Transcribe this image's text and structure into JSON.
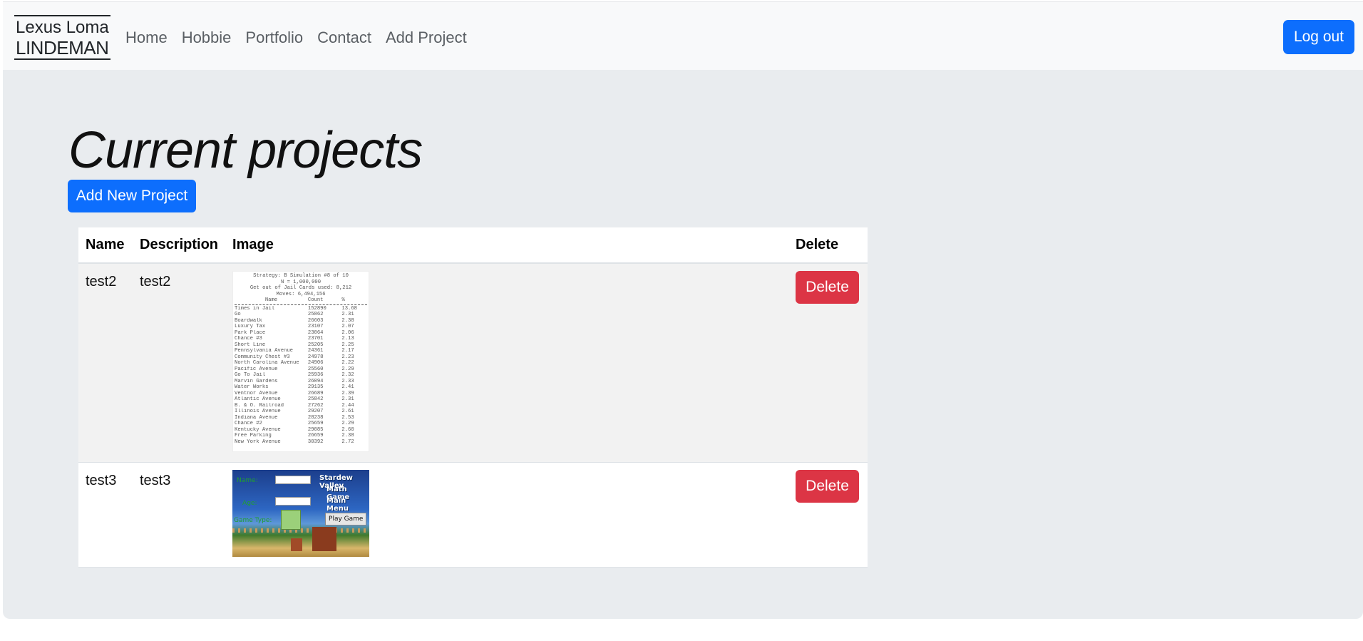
{
  "navbar": {
    "brand_line1": "Lexus Loma",
    "brand_line2": "LINDEMAN",
    "links": [
      "Home",
      "Hobbie",
      "Portfolio",
      "Contact",
      "Add Project"
    ],
    "logout_label": "Log out"
  },
  "main": {
    "title": "Current projects",
    "add_button": "Add New Project"
  },
  "table": {
    "headers": [
      "Name",
      "Description",
      "Image",
      "Delete"
    ],
    "rows": [
      {
        "name": "test2",
        "description": "test2",
        "delete_label": "Delete"
      },
      {
        "name": "test3",
        "description": "test3",
        "delete_label": "Delete"
      }
    ]
  },
  "thumb1": {
    "header_lines": [
      "Strategy: B Simulation #8 of 10",
      "N = 1,000,000",
      "Get out of Jail Cards used: 8,212",
      "Moves: 6,494,156"
    ],
    "col_headers": [
      "Name",
      "Count",
      "%"
    ],
    "rows": [
      [
        "Times in Jail",
        "152890",
        "13.68"
      ],
      [
        "Go",
        "25862",
        "2.31"
      ],
      [
        "Boardwalk",
        "26603",
        "2.38"
      ],
      [
        "Luxury Tax",
        "23107",
        "2.07"
      ],
      [
        "Park Place",
        "23064",
        "2.06"
      ],
      [
        "Chance #3",
        "23701",
        "2.13"
      ],
      [
        "Short Line",
        "25205",
        "2.25"
      ],
      [
        "Pennsylvania Avenue",
        "24361",
        "2.17"
      ],
      [
        "Community Chest #3",
        "24978",
        "2.23"
      ],
      [
        "North Carolina Avenue",
        "24906",
        "2.22"
      ],
      [
        "Pacific Avenue",
        "25560",
        "2.29"
      ],
      [
        "Go To Jail",
        "25936",
        "2.32"
      ],
      [
        "Marvin Gardens",
        "26094",
        "2.33"
      ],
      [
        "Water Works",
        "29135",
        "2.41"
      ],
      [
        "Ventnor Avenue",
        "26689",
        "2.39"
      ],
      [
        "Atlantic Avenue",
        "25842",
        "2.31"
      ],
      [
        "B. & O. Railroad",
        "27262",
        "2.44"
      ],
      [
        "Illinois Avenue",
        "29207",
        "2.61"
      ],
      [
        "Indiana Avenue",
        "28238",
        "2.53"
      ],
      [
        "Chance #2",
        "25659",
        "2.29"
      ],
      [
        "Kentucky Avenue",
        "29085",
        "2.60"
      ],
      [
        "Free Parking",
        "26659",
        "2.38"
      ],
      [
        "New York Avenue",
        "30392",
        "2.72"
      ]
    ]
  },
  "thumb2": {
    "title_lines": [
      "Stardew Valley",
      "Math Game",
      "Main Menu"
    ],
    "name_label": "Name:",
    "age_label": "Age:",
    "game_type_label": "Game Type:",
    "play_label": "Play Game"
  }
}
